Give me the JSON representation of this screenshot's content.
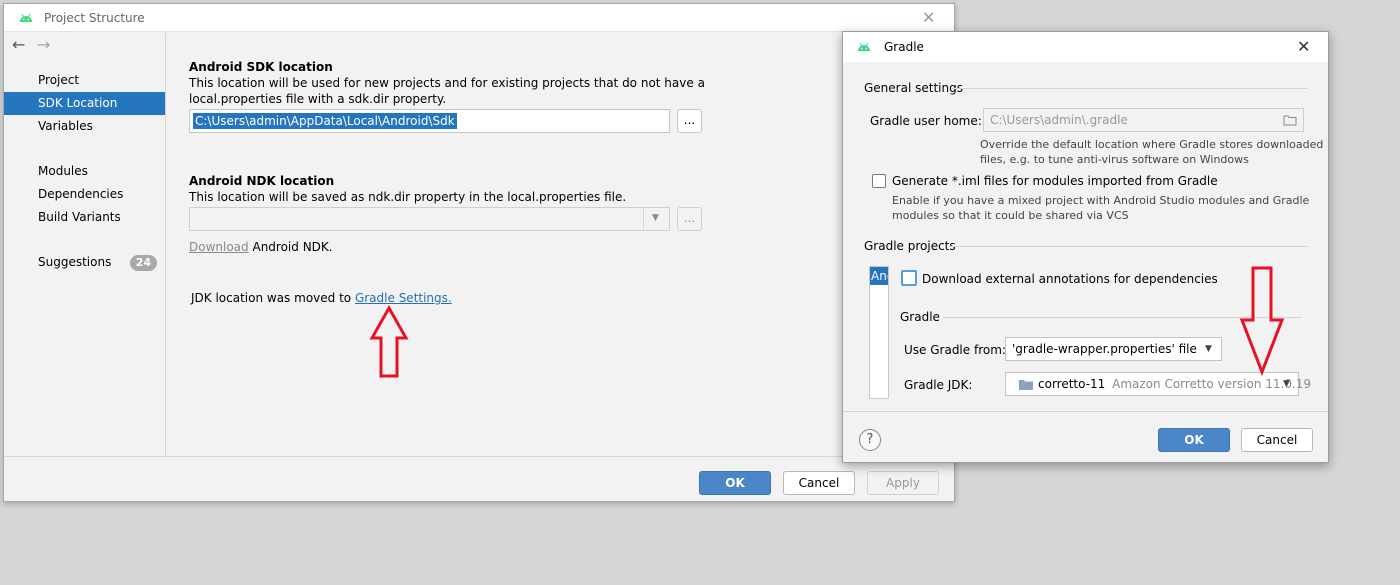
{
  "project_structure": {
    "title": "Project Structure",
    "nav": {
      "back": "←",
      "forward": "→",
      "items": [
        {
          "label": "Project"
        },
        {
          "label": "SDK Location"
        },
        {
          "label": "Variables"
        },
        {
          "label": "Modules"
        },
        {
          "label": "Dependencies"
        },
        {
          "label": "Build Variants"
        },
        {
          "label": "Suggestions",
          "badge": "24"
        }
      ]
    },
    "sdk": {
      "header": "Android SDK location",
      "desc_line1": "This location will be used for new projects and for existing projects that do not have a",
      "desc_line2": "local.properties file with a sdk.dir property.",
      "path": "C:\\Users\\admin\\AppData\\Local\\Android\\Sdk",
      "browse": "..."
    },
    "ndk": {
      "header": "Android NDK location",
      "desc": "This location will be saved as ndk.dir property in the local.properties file.",
      "browse": "...",
      "download_link": "Download",
      "download_rest": "Android NDK."
    },
    "jdk": {
      "text": "JDK location was moved to",
      "link": "Gradle Settings."
    },
    "buttons": {
      "ok": "OK",
      "cancel": "Cancel",
      "apply": "Apply"
    }
  },
  "gradle_dialog": {
    "title": "Gradle",
    "general_settings": "General settings",
    "user_home_label": "Gradle user home:",
    "user_home_value": "C:\\Users\\admin\\.gradle",
    "user_home_hint_line1": "Override the default location where Gradle stores downloaded",
    "user_home_hint_line2": "files, e.g. to tune anti-virus software on Windows",
    "generate_iml_label": "Generate *.iml files for modules imported from Gradle",
    "generate_iml_hint_line1": "Enable if you have a mixed project with Android Studio modules and Gradle",
    "generate_iml_hint_line2": "modules so that it could be shared via VCS",
    "gradle_projects": "Gradle projects",
    "project_item": "Anc",
    "download_annotations_label": "Download external annotations for dependencies",
    "gradle_section": "Gradle",
    "use_gradle_from_label": "Use Gradle from:",
    "use_gradle_from_value": "'gradle-wrapper.properties' file",
    "gradle_jdk_label": "Gradle JDK:",
    "gradle_jdk_name": "corretto-11",
    "gradle_jdk_version": "Amazon Corretto version 11.0.19",
    "help": "?",
    "buttons": {
      "ok": "OK",
      "cancel": "Cancel"
    }
  },
  "colors": {
    "accent_blue": "#2675bf",
    "annotation_red": "#e81123",
    "android_green": "#3ddc84"
  }
}
